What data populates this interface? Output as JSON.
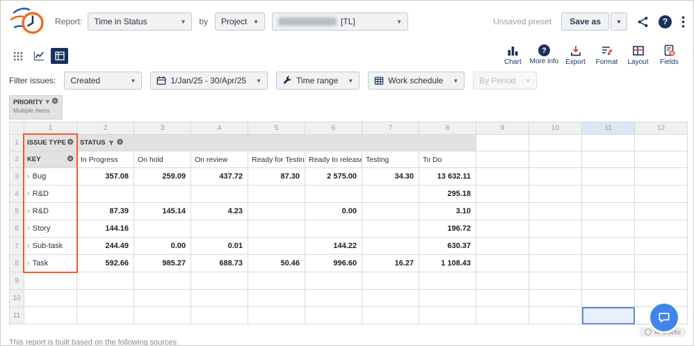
{
  "topbar": {
    "report_label": "Report:",
    "report_type_value": "Time in Status",
    "by_label": "by",
    "group_by_value": "Project",
    "project_value": "[TL]",
    "unsaved_preset_label": "Unsaved preset",
    "save_as_label": "Save as",
    "help_glyph": "?"
  },
  "viewbar": {
    "actions": [
      {
        "label": "Chart"
      },
      {
        "label": "More info"
      },
      {
        "label": "Export"
      },
      {
        "label": "Format"
      },
      {
        "label": "Layout"
      },
      {
        "label": "Fields"
      }
    ],
    "more_info_glyph": "?"
  },
  "filterbar": {
    "filter_issues_label": "Filter issues:",
    "filter_field_value": "Created",
    "date_range_value": "1/Jan/25 - 30/Apr/25",
    "time_range_label": "Time range",
    "work_schedule_label": "Work schedule",
    "by_period_label": "By Period"
  },
  "pivot": {
    "priority_label": "PRIORITY",
    "priority_value": "Multiple Items",
    "labels": {
      "issue_type": "ISSUE TYPE",
      "key": "KEY",
      "status": "STATUS"
    },
    "gear_glyph": "⚙",
    "expand_glyph": "›",
    "column_numbers": [
      "1",
      "2",
      "3",
      "4",
      "5",
      "6",
      "7",
      "8",
      "9",
      "10",
      "11",
      "12"
    ],
    "row_numbers": [
      "1",
      "2",
      "3",
      "4",
      "5",
      "6",
      "7",
      "8",
      "9",
      "10",
      "11"
    ],
    "status_columns": [
      "In Progress",
      "On hold",
      "On review",
      "Ready for Testing",
      "Ready to release",
      "Testing",
      "To Do"
    ],
    "rows": [
      {
        "label": "Bug",
        "values": [
          "357.08",
          "259.09",
          "437.72",
          "87.30",
          "2 575.00",
          "34.30",
          "13 632.11"
        ]
      },
      {
        "label": "R&D",
        "values": [
          "",
          "",
          "",
          "",
          "",
          "",
          "295.18"
        ]
      },
      {
        "label": "R&D",
        "values": [
          "87.39",
          "145.14",
          "4.23",
          "",
          "0.00",
          "",
          "3.10"
        ]
      },
      {
        "label": "Story",
        "values": [
          "144.16",
          "",
          "",
          "",
          "",
          "",
          "196.72"
        ]
      },
      {
        "label": "Sub-task",
        "values": [
          "244.49",
          "0.00",
          "0.01",
          "",
          "144.22",
          "",
          "630.37"
        ]
      },
      {
        "label": "Task",
        "values": [
          "592.66",
          "985.27",
          "688.73",
          "50.46",
          "996.60",
          "16.27",
          "1 108.43"
        ]
      }
    ]
  },
  "footer": {
    "source_note": "This report is built based on the following sources:",
    "watermark": "W Stocks"
  },
  "colors": {
    "accent_navy": "#17335d",
    "accent_red": "#d93a2b",
    "annotation_orange": "#ff5227",
    "selection_blue": "#5b8bd6",
    "header_gray": "#e2e2e2"
  }
}
